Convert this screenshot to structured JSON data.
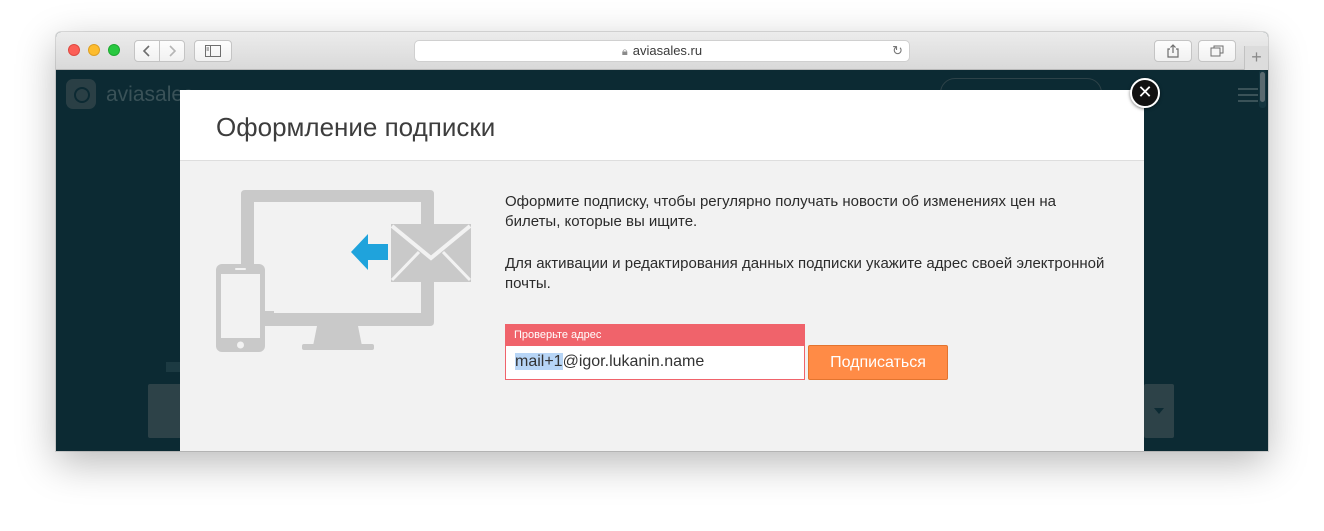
{
  "browser": {
    "url": "aviasales.ru",
    "new_tab_label": "+"
  },
  "background": {
    "brand": "aviasales"
  },
  "modal": {
    "title": "Оформление подписки",
    "close_label": "✕",
    "description_line1": "Оформите подписку, чтобы регулярно получать новости об изменениях цен на",
    "description_line2": "билеты, которые вы ищите.",
    "description_activation": "Для активации и редактирования данных подписки укажите адрес своей электронной почты.",
    "error_message": "Проверьте адрес",
    "email": {
      "selected_part": "mail+1",
      "rest_part": "@igor.lukanin.name"
    },
    "subscribe_label": "Подписаться"
  },
  "colors": {
    "error": "#f0636b",
    "accent": "#ff8b46",
    "page_bg": "#0c2a33",
    "illustration": "#c9c9c9",
    "arrow": "#1fa3dc"
  },
  "icons": [
    "lock-icon",
    "reload-icon",
    "back-chevron-icon",
    "forward-chevron-icon",
    "sidebar-icon",
    "share-icon",
    "tabs-icon",
    "close-icon",
    "monitor-icon",
    "phone-icon",
    "envelope-icon",
    "arrow-left-icon"
  ]
}
